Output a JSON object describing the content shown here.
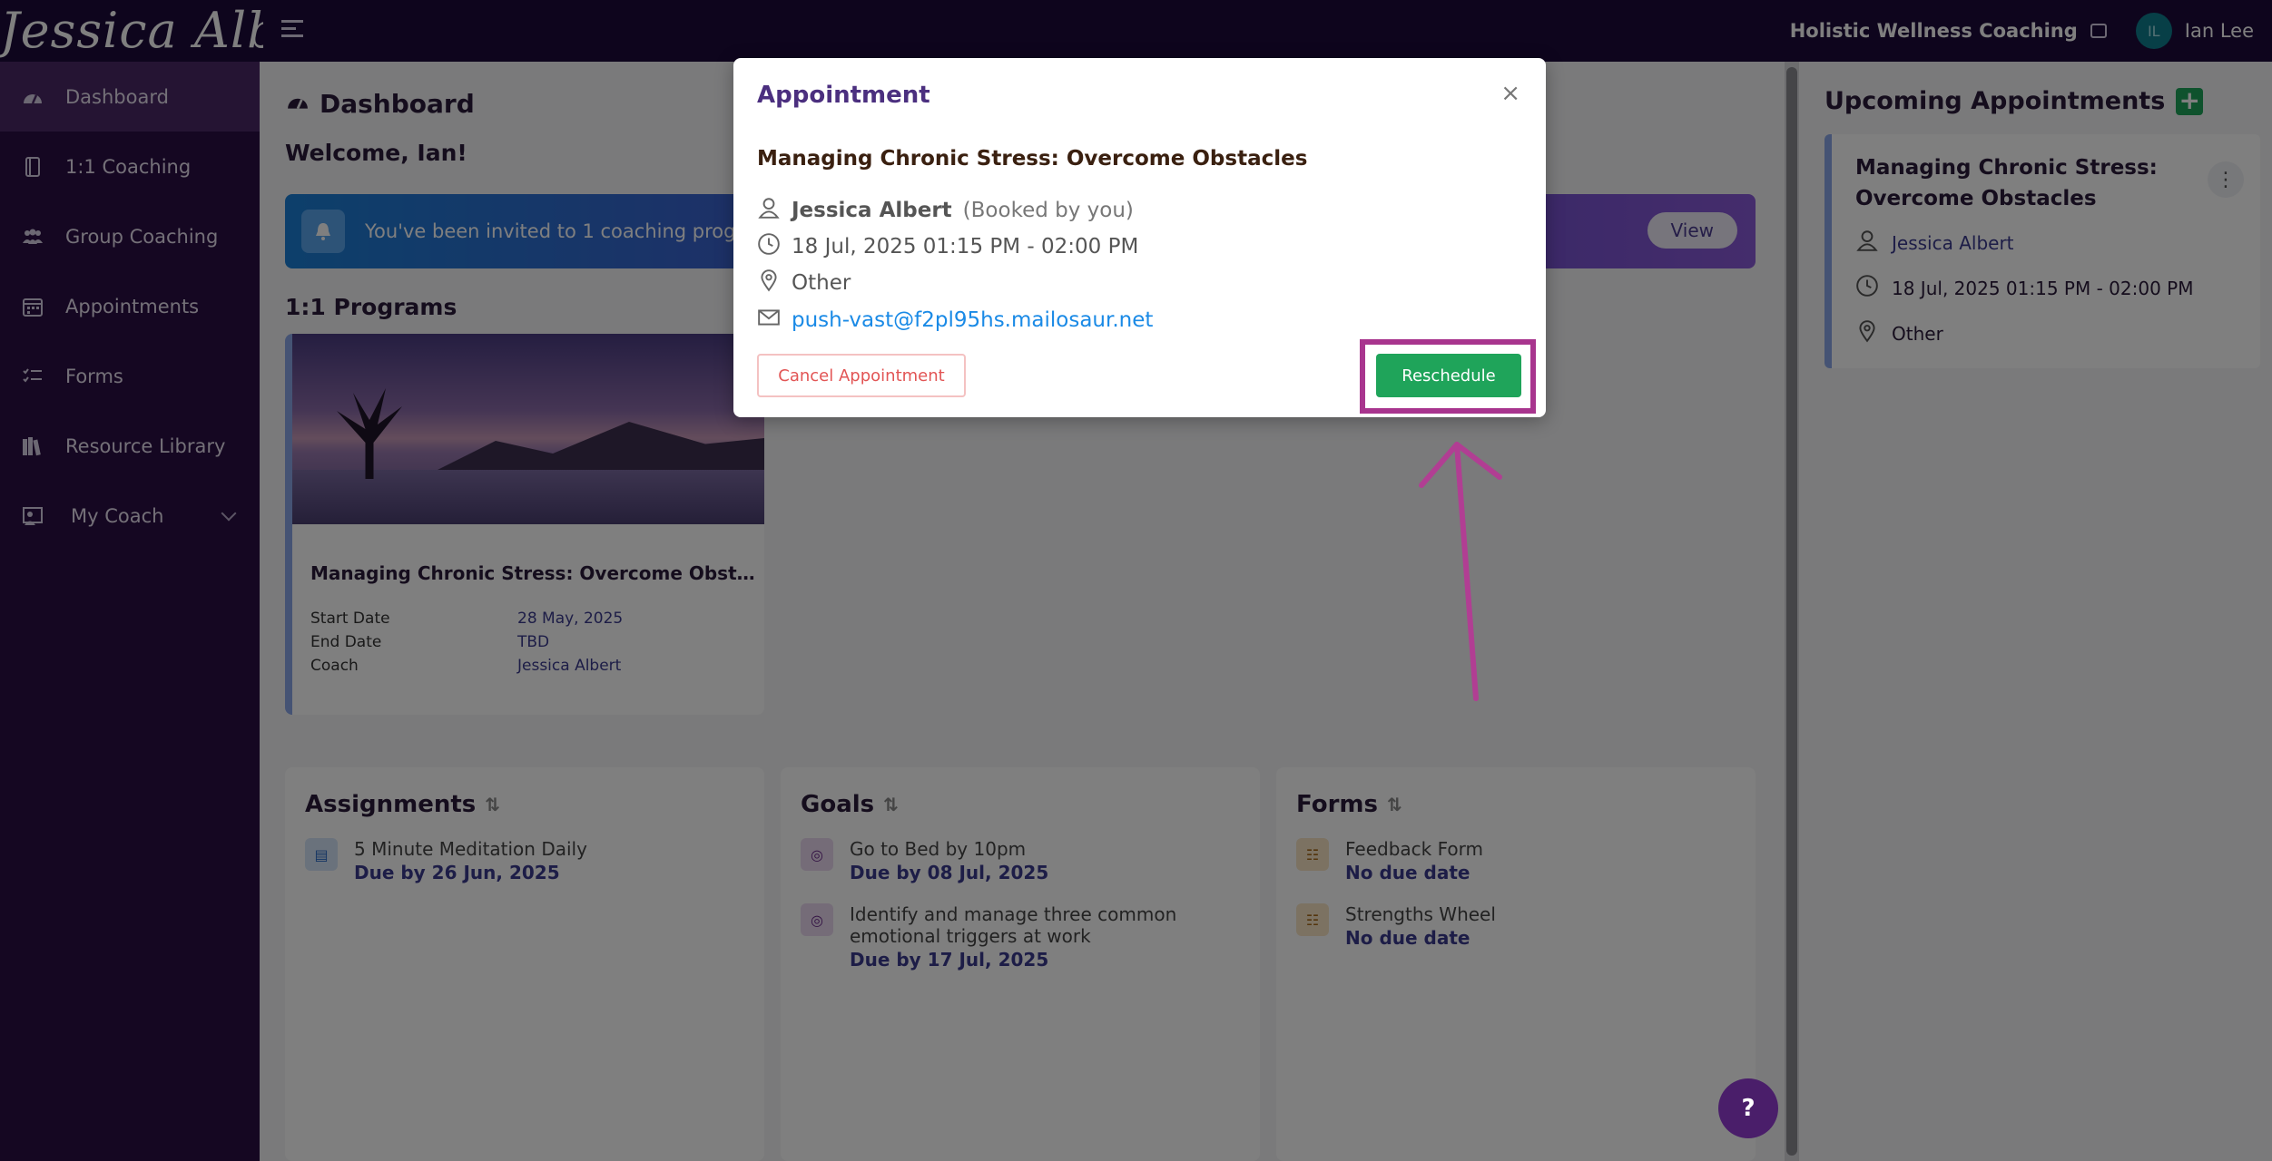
{
  "header": {
    "logo_text": "Jessica Albert",
    "business_name": "Holistic Wellness Coaching",
    "avatar_initials": "IL",
    "user_name": "Ian Lee"
  },
  "sidebar": {
    "items": [
      {
        "label": "Dashboard",
        "icon": "dashboard-icon",
        "active": true
      },
      {
        "label": "1:1 Coaching",
        "icon": "book-icon"
      },
      {
        "label": "Group Coaching",
        "icon": "users-icon"
      },
      {
        "label": "Appointments",
        "icon": "calendar-icon"
      },
      {
        "label": "Forms",
        "icon": "checklist-icon"
      },
      {
        "label": "Resource Library",
        "icon": "library-icon"
      },
      {
        "label": "My Coach",
        "icon": "coach-icon",
        "has_chevron": true
      }
    ]
  },
  "main": {
    "page_title": "Dashboard",
    "welcome": "Welcome, Ian!",
    "banner_text": "You've been invited to 1 coaching progr",
    "banner_button": "View",
    "programs_title": "1:1 Programs",
    "program": {
      "name": "Managing Chronic Stress: Overcome Obsta...",
      "rows": [
        {
          "key": "Start Date",
          "value": "28 May, 2025"
        },
        {
          "key": "End Date",
          "value": "TBD"
        },
        {
          "key": "Coach",
          "value": "Jessica Albert"
        }
      ]
    },
    "assignments": {
      "title": "Assignments",
      "items": [
        {
          "line1": "5 Minute Meditation Daily",
          "line2": "Due by 26 Jun, 2025"
        }
      ]
    },
    "goals": {
      "title": "Goals",
      "items": [
        {
          "line1": "Go to Bed by 10pm",
          "line2": "Due by 08 Jul, 2025"
        },
        {
          "line1": "Identify and manage three common",
          "line1b": "emotional triggers at work",
          "line2": "Due by 17 Jul, 2025"
        }
      ]
    },
    "forms": {
      "title": "Forms",
      "items": [
        {
          "line1": "Feedback Form",
          "line2": "No due date"
        },
        {
          "line1": "Strengths Wheel",
          "line2": "No due date"
        }
      ]
    }
  },
  "right_panel": {
    "title": "Upcoming Appointments",
    "card": {
      "title_line1": "Managing Chronic Stress:",
      "title_line2": "Overcome Obstacles",
      "coach": "Jessica Albert",
      "time": "18 Jul, 2025 01:15 PM - 02:00 PM",
      "location": "Other"
    }
  },
  "modal": {
    "title": "Appointment",
    "close_glyph": "×",
    "event_name": "Managing Chronic Stress: Overcome Obstacles",
    "coach": "Jessica Albert",
    "booked_note": "(Booked by you)",
    "time": "18 Jul, 2025 01:15 PM - 02:00 PM",
    "location": "Other",
    "email": "push-vast@f2pl95hs.mailosaur.net",
    "cancel_label": "Cancel Appointment",
    "reschedule_label": "Reschedule"
  },
  "help": {
    "label": "?"
  },
  "colors": {
    "topbar": "#1c0b3a",
    "sidebar": "#2b0e44",
    "accent_green": "#1fa45a",
    "highlight": "#a8358e",
    "link": "#1a8ae6"
  }
}
